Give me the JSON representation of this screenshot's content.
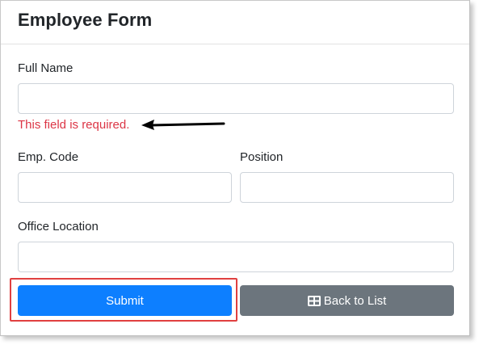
{
  "form": {
    "title": "Employee Form",
    "full_name": {
      "label": "Full Name",
      "value": "",
      "error": "This field is required."
    },
    "emp_code": {
      "label": "Emp. Code",
      "value": ""
    },
    "position": {
      "label": "Position",
      "value": ""
    },
    "office_location": {
      "label": "Office Location",
      "value": ""
    },
    "submit_label": "Submit",
    "back_label": "Back to List",
    "back_icon": "table-icon"
  },
  "colors": {
    "primary": "#0d7fff",
    "secondary": "#6c757d",
    "error": "#dc3545",
    "highlight": "#e04040"
  }
}
